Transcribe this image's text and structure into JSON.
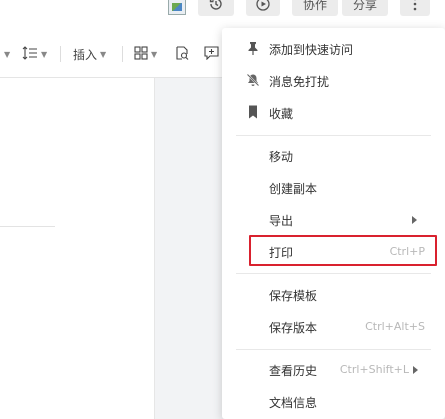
{
  "header": {
    "collaborate_label": "协作",
    "share_label": "分享",
    "icons": [
      "broken-image-icon",
      "history-icon",
      "play-icon",
      "more-vertical-icon"
    ]
  },
  "toolbar": {
    "insert_label": "插入",
    "icons": [
      "line-spacing-icon",
      "grid-layout-icon",
      "find-replace-icon",
      "add-comment-icon"
    ]
  },
  "menu": {
    "items": [
      {
        "label": "添加到快速访问",
        "icon": "pin-icon"
      },
      {
        "label": "消息免打扰",
        "icon": "bell-off-icon"
      },
      {
        "label": "收藏",
        "icon": "bookmark-icon"
      },
      {
        "label": "移动"
      },
      {
        "label": "创建副本"
      },
      {
        "label": "导出",
        "submenu": true
      },
      {
        "label": "打印",
        "shortcut": "Ctrl+P",
        "highlighted": true
      },
      {
        "label": "保存模板"
      },
      {
        "label": "保存版本",
        "shortcut": "Ctrl+Alt+S"
      },
      {
        "label": "查看历史",
        "shortcut": "Ctrl+Shift+L",
        "submenu": true
      },
      {
        "label": "文档信息"
      }
    ]
  },
  "colors": {
    "highlight_border": "#d9212e",
    "menu_background": "#ffffff",
    "shortcut_text": "#b8b8b8"
  }
}
